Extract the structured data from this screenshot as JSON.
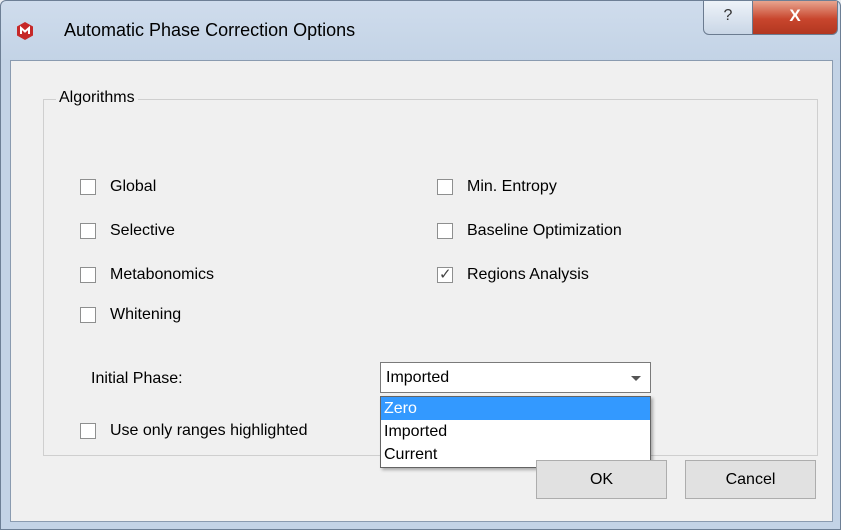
{
  "window": {
    "title": "Automatic Phase Correction Options",
    "help_glyph": "?",
    "close_glyph": "X",
    "app_icon": "mnova-logo-icon",
    "accent_color": "#c62828"
  },
  "algorithms": {
    "title": "Algorithms",
    "left": [
      {
        "label": "Global",
        "checked": false
      },
      {
        "label": "Selective",
        "checked": false
      },
      {
        "label": "Metabonomics",
        "checked": false
      },
      {
        "label": "Whitening",
        "checked": false
      }
    ],
    "right": [
      {
        "label": "Min. Entropy",
        "checked": false
      },
      {
        "label": "Baseline Optimization",
        "checked": false
      },
      {
        "label": "Regions Analysis",
        "checked": true
      }
    ]
  },
  "initial_phase": {
    "label": "Initial Phase:",
    "value": "Imported",
    "options": [
      "Zero",
      "Imported",
      "Current"
    ],
    "highlighted": "Zero"
  },
  "use_ranges": {
    "label": "Use only ranges highlighted",
    "checked": false
  },
  "buttons": {
    "ok": "OK",
    "cancel": "Cancel"
  },
  "check_glyph": "✓"
}
